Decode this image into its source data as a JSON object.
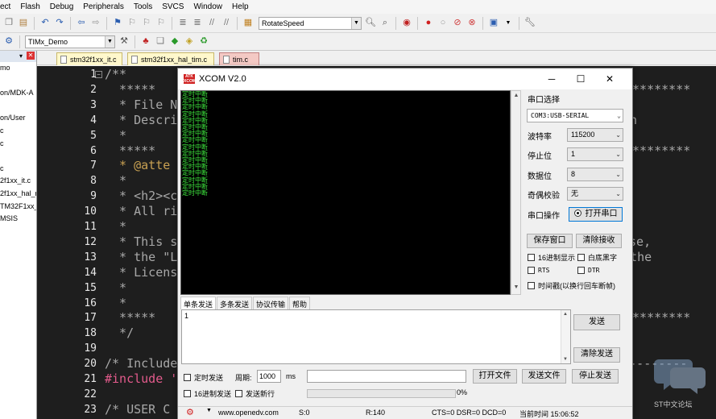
{
  "menu": [
    "ect",
    "Flash",
    "Debug",
    "Peripherals",
    "Tools",
    "SVCS",
    "Window",
    "Help"
  ],
  "toolbar": {
    "target_combo": "RotateSpeed",
    "project_combo": "TIMx_Demo"
  },
  "project_tree": [
    "mo",
    "",
    "on/MDK-A",
    "",
    "on/User",
    "c",
    "c",
    "",
    "c",
    "2f1xx_it.c",
    "2f1xx_hal_r",
    "TM32F1xx_",
    "MSIS"
  ],
  "tabs": [
    "stm32f1xx_it.c",
    "stm32f1xx_hal_tim.c",
    "tim.c"
  ],
  "line_numbers": [
    "1",
    "2",
    "3",
    "4",
    "5",
    "6",
    "7",
    "8",
    "9",
    "10",
    "11",
    "12",
    "13",
    "14",
    "15",
    "16",
    "17",
    "18",
    "19",
    "20",
    "21",
    "22",
    "23"
  ],
  "code": {
    "l1": "/**",
    "l2": "  *****",
    "l3": "  * File N",
    "l4": "  * Descri",
    "l5": "  *",
    "l6": "  *****",
    "l7": "  * @atte",
    "l8": "  *",
    "l9": "  * <h2><c",
    "l10": "  * All ri",
    "l11": "  *",
    "l12": "  * This s",
    "l13": "  * the \"L",
    "l14": "  * Licens",
    "l15": "  *",
    "l16": "  *",
    "l17": "  *****",
    "l18": "  */",
    "l19": "",
    "l20": "/* Include",
    "l21": "#include '",
    "l22": "",
    "l23": "/* USER C",
    "r2": "*********",
    "r4": "n",
    "r6": "*********",
    "r12": "nse,",
    "r13": "h the",
    "r17": "*********",
    "r20": "-------------"
  },
  "xcom": {
    "title": "XCOM V2.0",
    "logo": "ATK XCOM",
    "received_lines": [
      "定时中断",
      "定时中断",
      "定时中断",
      "定时中断",
      "定时中断",
      "定时中断",
      "定时中断",
      "定时中断",
      "定时中断",
      "定时中断",
      "定时中断",
      "定时中断",
      "定时中断",
      "定时中断",
      "定时中断",
      "定时中断"
    ],
    "port_select_label": "串口选择",
    "port_value": "COM3:USB-SERIAL",
    "baud_label": "波特率",
    "baud_value": "115200",
    "stop_label": "停止位",
    "stop_value": "1",
    "data_label": "数据位",
    "data_value": "8",
    "parity_label": "奇偶校验",
    "parity_value": "无",
    "op_label": "串口操作",
    "open_port_button": "打开串口",
    "save_window_button": "保存窗口",
    "clear_recv_button": "清除接收",
    "hex_display": "16进制显示",
    "white_bg": "白底黑字",
    "rts": "RTS",
    "dtr": "DTR",
    "timestamp": "时间戳(以换行回车断帧)",
    "send_tabs": [
      "单条发送",
      "多条发送",
      "协议传输",
      "帮助"
    ],
    "send_text": "1",
    "send_button": "发送",
    "clear_send_button": "清除发送",
    "timed_send": "定时发送",
    "period_label": "周期:",
    "period_value": "1000",
    "ms_label": "ms",
    "open_file_button": "打开文件",
    "send_file_button": "发送文件",
    "stop_send_button": "停止发送",
    "hex_send": "16进制发送",
    "send_newline": "发送新行",
    "progress_text": "0%",
    "status": {
      "url": "www.openedv.com",
      "s": "S:0",
      "r": "R:140",
      "lines": "CTS=0 DSR=0 DCD=0",
      "time": "当前时间 15:06:52"
    }
  },
  "watermark": "ST中文论坛"
}
